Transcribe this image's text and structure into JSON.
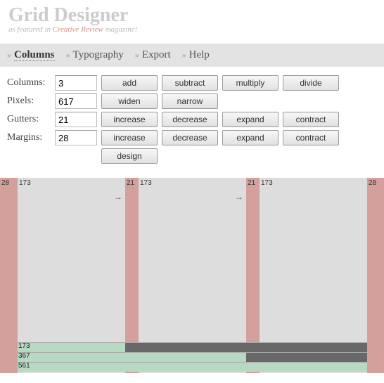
{
  "header": {
    "title": "Grid Designer",
    "tagline_pre": "as featured in ",
    "tagline_mag": "Creative Review",
    "tagline_post": " magazine!"
  },
  "nav": {
    "tabs": [
      {
        "label": "Columns",
        "active": true
      },
      {
        "label": "Typography",
        "active": false
      },
      {
        "label": "Export",
        "active": false
      },
      {
        "label": "Help",
        "active": false
      }
    ]
  },
  "fields": {
    "columns": {
      "label": "Columns:",
      "value": "3",
      "b1": "add",
      "b2": "subtract",
      "b3": "multiply",
      "b4": "divide"
    },
    "pixels": {
      "label": "Pixels:",
      "value": "617",
      "b1": "widen",
      "b2": "narrow"
    },
    "gutters": {
      "label": "Gutters:",
      "value": "21",
      "b1": "increase",
      "b2": "decrease",
      "b3": "expand",
      "b4": "contract"
    },
    "margins": {
      "label": "Margins:",
      "value": "28",
      "b1": "increase",
      "b2": "decrease",
      "b3": "expand",
      "b4": "contract"
    },
    "design": {
      "label": "design"
    }
  },
  "preview": {
    "margin_label": "28",
    "col_label": "173",
    "gutter_label": "21",
    "sums": [
      "173",
      "367",
      "561"
    ]
  }
}
